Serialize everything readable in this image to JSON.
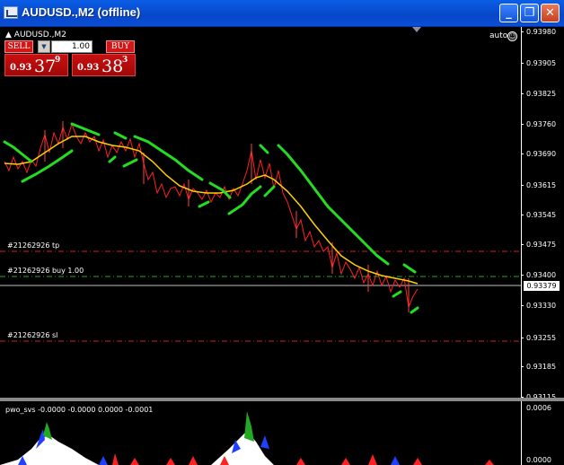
{
  "window": {
    "title": "AUDUSD.,M2 (offline)",
    "minimize_glyph": "_",
    "restore_glyph": "❐",
    "close_glyph": "✕"
  },
  "chart": {
    "symbol": "AUDUSD.,M2",
    "auto_label": "auto",
    "smiley_glyph": "☺",
    "colors": {
      "background": "#000000",
      "price_line": "#ff2020",
      "ma_line": "#ffd000",
      "envelope": "#22dd22",
      "tp_line": "#cc2020",
      "entry_line": "#22aa22",
      "sl_line": "#cc2020"
    },
    "price_scale": [
      "0.93980",
      "0.93905",
      "0.93825",
      "0.93760",
      "0.93690",
      "0.93615",
      "0.93545",
      "0.93475",
      "0.93400",
      "0.93330",
      "0.93255",
      "0.93185",
      "0.93115"
    ],
    "current_price": "0.93379",
    "orders": {
      "tp": "#21262926 tp",
      "entry": "#21262926 buy 1.00",
      "sl": "#21262926 sl"
    }
  },
  "trade_panel": {
    "sell_label": "SELL",
    "buy_label": "BUY",
    "lot_value": "1.00",
    "spin_glyph": "▼",
    "sell_price": {
      "prefix": "0.93",
      "big": "37",
      "sup": "9"
    },
    "buy_price": {
      "prefix": "0.93",
      "big": "38",
      "sup": "3"
    }
  },
  "indicator": {
    "label": "pwo_svs -0.0000 -0.0000 0.0000 -0.0001",
    "scale": [
      "0.0006",
      "0.0000"
    ]
  }
}
